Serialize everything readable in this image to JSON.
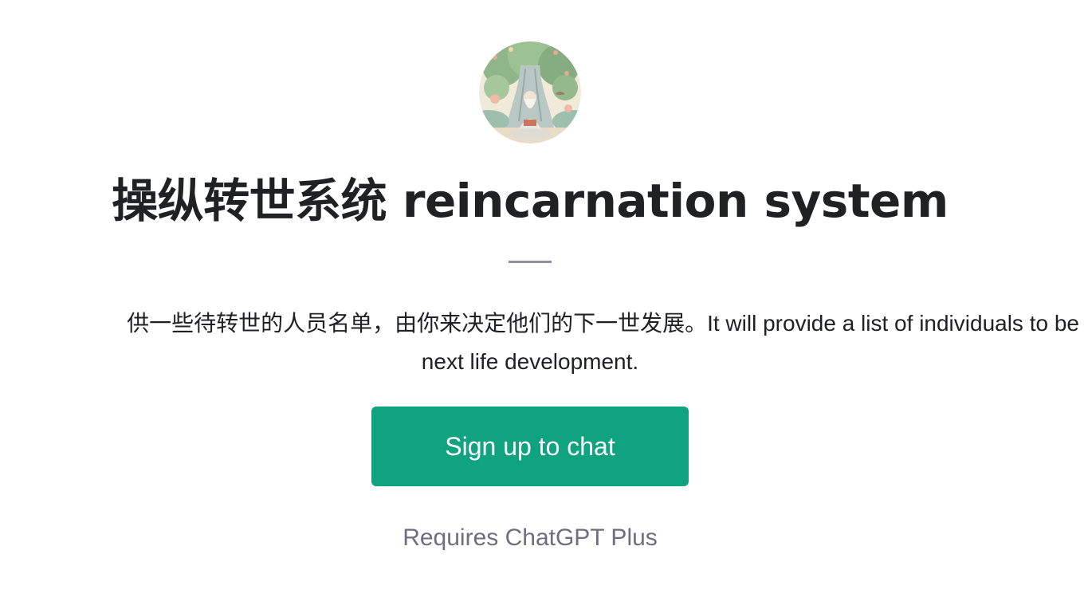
{
  "gpt": {
    "avatar_icon": "sage-under-tree-avatar",
    "title": "操纵转世系统 reincarnation system",
    "description_line1": "供一些待转世的人员名单，由你来决定他们的下一世发展。It will provide a list of individuals to be",
    "description_line2": "next life development.",
    "signup_label": "Sign up to chat",
    "requirement": "Requires ChatGPT Plus"
  },
  "colors": {
    "accent": "#10a37f",
    "text": "#202123",
    "muted": "#6e6e80",
    "divider": "#8e8ea0"
  }
}
